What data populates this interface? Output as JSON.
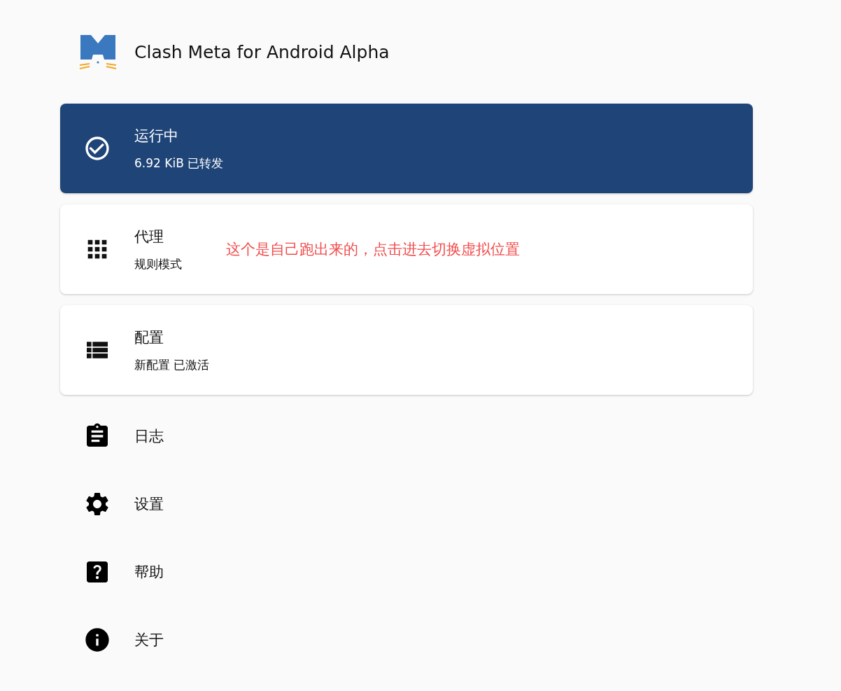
{
  "app": {
    "title": "Clash Meta for Android Alpha"
  },
  "cards": [
    {
      "kind": "status",
      "title": "运行中",
      "subtitle": "6.92 KiB 已转发"
    },
    {
      "kind": "proxy",
      "title": "代理",
      "subtitle": "规则模式",
      "note": "这个是自己跑出来的，点击进去切换虚拟位置"
    },
    {
      "kind": "profile",
      "title": "配置",
      "subtitle": "新配置 已激活"
    }
  ],
  "menu": [
    {
      "kind": "logs",
      "label": "日志"
    },
    {
      "kind": "settings",
      "label": "设置"
    },
    {
      "kind": "help",
      "label": "帮助"
    },
    {
      "kind": "about",
      "label": "关于"
    }
  ]
}
